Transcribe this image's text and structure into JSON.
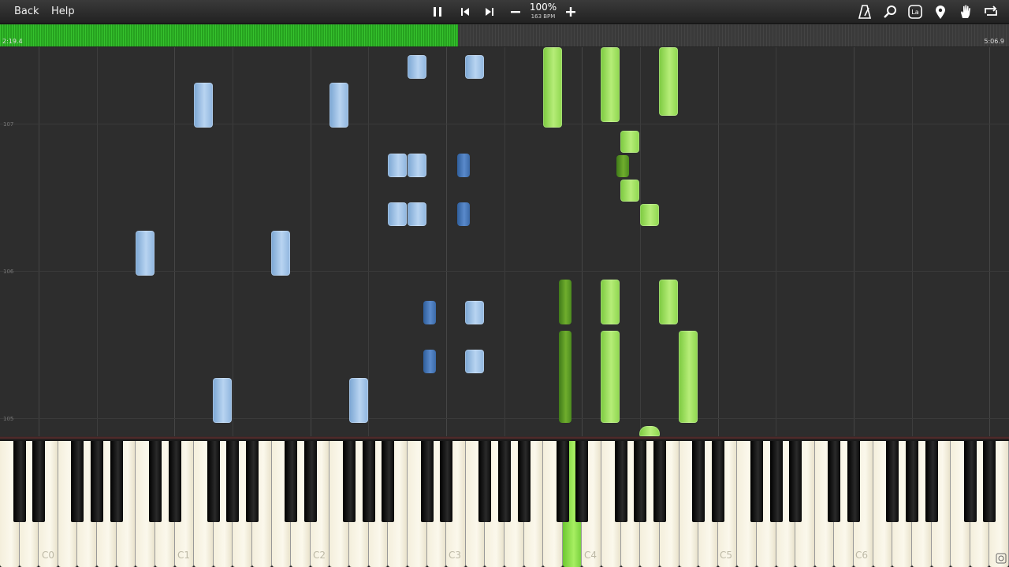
{
  "toolbar": {
    "back_label": "Back",
    "help_label": "Help",
    "speed_percent": "100%",
    "tempo": "163 BPM",
    "icons": [
      "pause-icon",
      "skip-back-icon",
      "skip-forward-icon",
      "minus-icon",
      "plus-icon",
      "metronome-icon",
      "search-icon",
      "label-icon",
      "location-pin-icon",
      "hand-icon",
      "loop-icon"
    ],
    "label_icon_text": "La"
  },
  "progress": {
    "elapsed": "2:19.4",
    "total": "5:06.9",
    "fraction": 0.454
  },
  "roll": {
    "measure_labels": [
      "107",
      "106",
      "105"
    ]
  },
  "keyboard": {
    "octave_labels": [
      "C0",
      "C1",
      "C2",
      "C3",
      "C4",
      "C5",
      "C6"
    ],
    "pressed_key": "D4"
  },
  "colors": {
    "left_hand": "#a9c8ec",
    "right_hand": "#9be05a",
    "progress": "#2fb327"
  }
}
